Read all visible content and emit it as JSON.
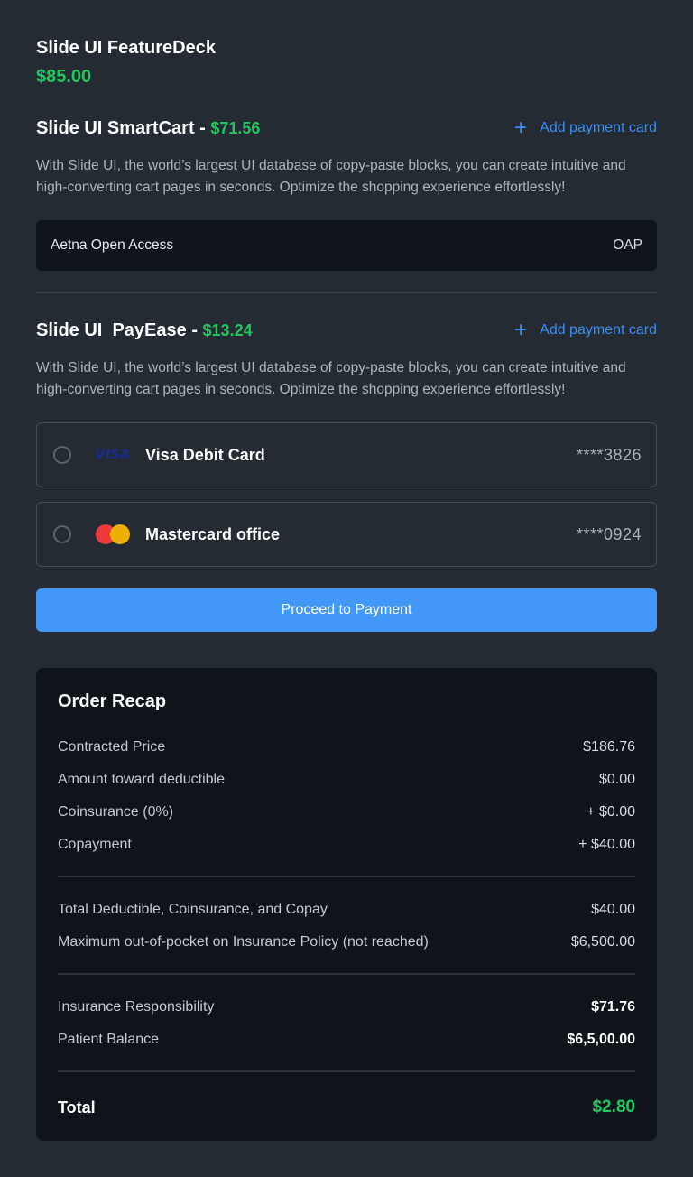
{
  "product": {
    "title": "Slide UI FeatureDeck",
    "price": "$85.00"
  },
  "section1": {
    "title": "Slide UI SmartCart - ",
    "price": "$71.56",
    "add_card": "Add payment card",
    "description": "With Slide UI, the world’s largest UI database of copy-paste blocks, you can create intuitive and high-converting cart pages in seconds. Optimize the shopping experience effortlessly!",
    "insurance": {
      "name": "Aetna Open Access",
      "code": "OAP"
    }
  },
  "section2": {
    "title": "Slide UI  PayEase - ",
    "price": "$13.24",
    "add_card": "Add payment card",
    "description": "With Slide UI, the world’s largest UI database of copy-paste blocks, you can create intuitive and high-converting cart pages in seconds. Optimize the shopping experience effortlessly!",
    "cards": [
      {
        "logo": "VISA",
        "icon": "visa-logo-icon",
        "name": "Visa Debit Card",
        "number": "****3826",
        "selected": false
      },
      {
        "icon": "mastercard-logo-icon",
        "name": "Mastercard office",
        "number": "****0924",
        "selected": false
      }
    ]
  },
  "proceed_label": "Proceed to Payment",
  "recap": {
    "title": "Order Recap",
    "group1": [
      {
        "label": "Contracted Price",
        "value": "$186.76"
      },
      {
        "label": "Amount toward deductible",
        "value": "$0.00"
      },
      {
        "label": "Coinsurance (0%)",
        "value": "+ $0.00"
      },
      {
        "label": "Copayment",
        "value": "+ $40.00"
      }
    ],
    "group2": [
      {
        "label": "Total Deductible, Coinsurance, and Copay",
        "value": "$40.00"
      },
      {
        "label": "Maximum out-of-pocket on Insurance Policy (not reached)",
        "value": "$6,500.00"
      }
    ],
    "group3": [
      {
        "label": "Insurance Responsibility",
        "value": "$71.76"
      },
      {
        "label": "Patient Balance",
        "value": "$6,5,00.00"
      }
    ],
    "total_label": "Total",
    "total_value": "$2.80"
  },
  "colors": {
    "background": "#252b33",
    "panel": "#0f141b",
    "accent_green": "#22c55e",
    "accent_blue": "#4397f7",
    "link_blue": "#3b8ef0"
  }
}
